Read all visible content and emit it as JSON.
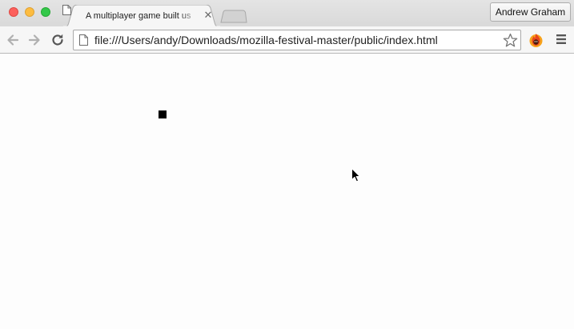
{
  "window": {
    "tab": {
      "title": "A multiplayer game built us",
      "close_label": "✕"
    },
    "profile": {
      "name": "Andrew Graham"
    }
  },
  "toolbar": {
    "address": {
      "url": "file:///Users/andy/Downloads/mozilla-festival-master/public/index.html"
    },
    "icons": {
      "back": "back-arrow-icon",
      "forward": "forward-arrow-icon",
      "reload": "reload-icon",
      "page": "page-icon",
      "star": "star-icon",
      "extension": "fire-extension-icon",
      "menu": "hamburger-menu-icon"
    }
  },
  "game": {
    "player_color": "#000000"
  },
  "colors": {
    "close": "#fc605c",
    "minimize": "#fdbc40",
    "maximize": "#34c84a"
  }
}
